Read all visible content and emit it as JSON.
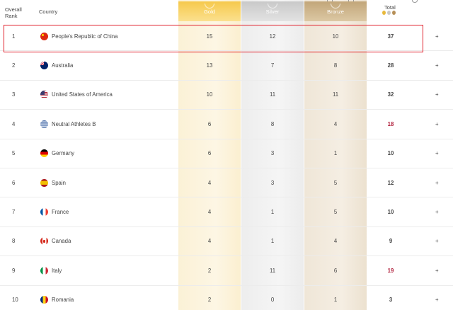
{
  "header": {
    "rank_line1": "Overall",
    "rank_line2": "Rank",
    "country": "Country",
    "gold": "Gold",
    "silver": "Silver",
    "bronze": "Bronze",
    "total": "Total"
  },
  "colors": {
    "gold": "#f6c94c",
    "silver": "#c9c9c9",
    "bronze": "#c2a679",
    "highlight": "#e0202c",
    "total_red": "#b01e3a"
  },
  "rows": [
    {
      "rank": "1",
      "flag": "china-flag-icon",
      "country": "People's Republic of China",
      "gold": "15",
      "silver": "12",
      "bronze": "10",
      "total": "37",
      "total_red": false
    },
    {
      "rank": "2",
      "flag": "australia-flag-icon",
      "country": "Australia",
      "gold": "13",
      "silver": "7",
      "bronze": "8",
      "total": "28",
      "total_red": false
    },
    {
      "rank": "3",
      "flag": "usa-flag-icon",
      "country": "United States of America",
      "gold": "10",
      "silver": "11",
      "bronze": "11",
      "total": "32",
      "total_red": false
    },
    {
      "rank": "4",
      "flag": "neutral-athletes-flag-icon",
      "country": "Neutral Athletes B",
      "gold": "6",
      "silver": "8",
      "bronze": "4",
      "total": "18",
      "total_red": true
    },
    {
      "rank": "5",
      "flag": "germany-flag-icon",
      "country": "Germany",
      "gold": "6",
      "silver": "3",
      "bronze": "1",
      "total": "10",
      "total_red": false
    },
    {
      "rank": "6",
      "flag": "spain-flag-icon",
      "country": "Spain",
      "gold": "4",
      "silver": "3",
      "bronze": "5",
      "total": "12",
      "total_red": false
    },
    {
      "rank": "7",
      "flag": "france-flag-icon",
      "country": "France",
      "gold": "4",
      "silver": "1",
      "bronze": "5",
      "total": "10",
      "total_red": false
    },
    {
      "rank": "8",
      "flag": "canada-flag-icon",
      "country": "Canada",
      "gold": "4",
      "silver": "1",
      "bronze": "4",
      "total": "9",
      "total_red": false
    },
    {
      "rank": "9",
      "flag": "italy-flag-icon",
      "country": "Italy",
      "gold": "2",
      "silver": "11",
      "bronze": "6",
      "total": "19",
      "total_red": true
    },
    {
      "rank": "10",
      "flag": "romania-flag-icon",
      "country": "Romania",
      "gold": "2",
      "silver": "0",
      "bronze": "1",
      "total": "3",
      "total_red": false
    }
  ],
  "expand_symbol": "+"
}
